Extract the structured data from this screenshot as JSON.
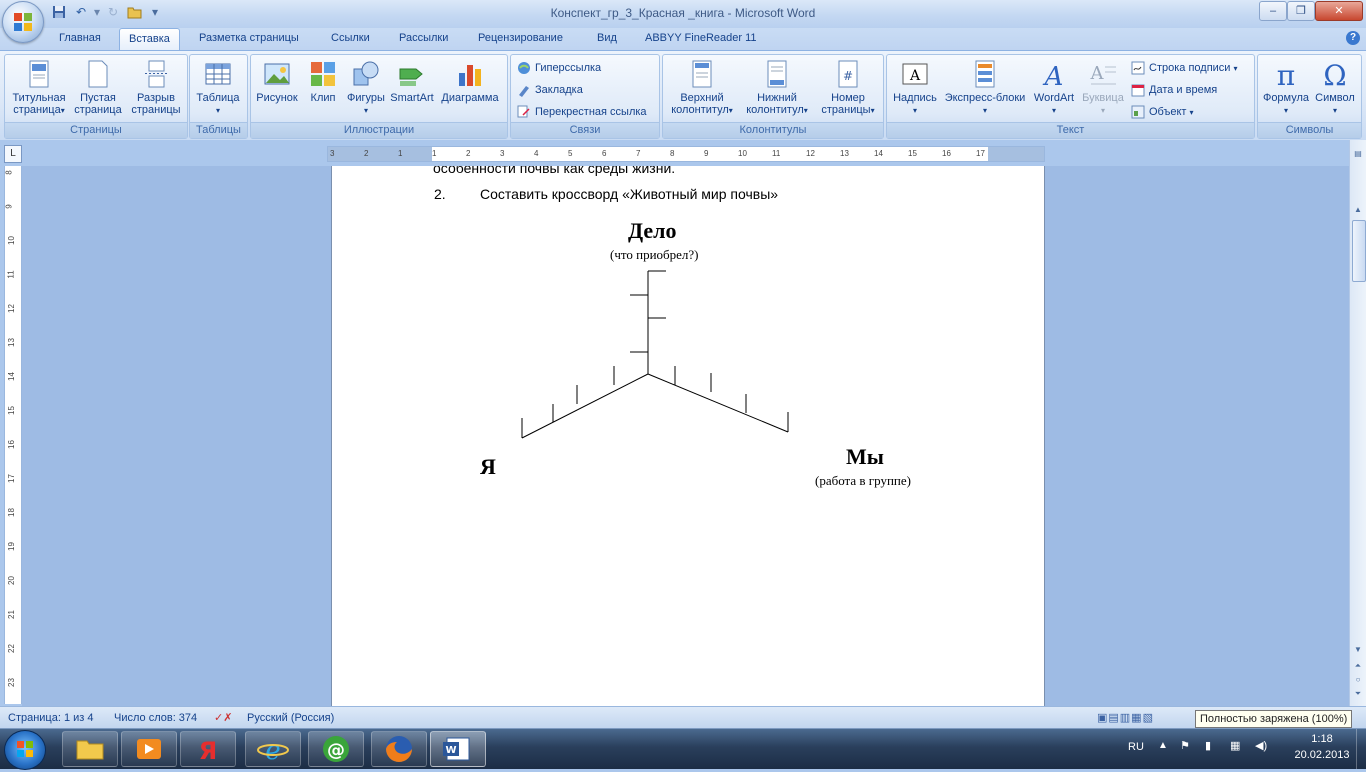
{
  "window": {
    "title": "Конспект_гр_3_Красная _книга - Microsoft Word",
    "qat": {
      "save": "save-icon",
      "undo": "undo-icon",
      "redo": "redo-icon",
      "open": "open-icon"
    }
  },
  "tabs": [
    "Главная",
    "Вставка",
    "Разметка страницы",
    "Ссылки",
    "Рассылки",
    "Рецензирование",
    "Вид",
    "ABBYY FineReader 11"
  ],
  "active_tab": "Вставка",
  "ribbon": {
    "pages": {
      "label": "Страницы",
      "cover": "Титульная страница",
      "blank": "Пустая страница",
      "break": "Разрыв страницы"
    },
    "tables": {
      "label": "Таблицы",
      "table": "Таблица"
    },
    "illustrations": {
      "label": "Иллюстрации",
      "picture": "Рисунок",
      "clip": "Клип",
      "shapes": "Фигуры",
      "smartart": "SmartArt",
      "chart": "Диаграмма"
    },
    "links": {
      "label": "Связи",
      "hyperlink": "Гиперссылка",
      "bookmark": "Закладка",
      "crossref": "Перекрестная ссылка"
    },
    "headers": {
      "label": "Колонтитулы",
      "header": "Верхний колонтитул",
      "footer": "Нижний колонтитул",
      "pagenum": "Номер страницы"
    },
    "text": {
      "label": "Текст",
      "textbox": "Надпись",
      "quickparts": "Экспресс-блоки",
      "wordart": "WordArt",
      "dropcap": "Буквица",
      "signature": "Строка подписи",
      "datetime": "Дата и время",
      "object": "Объект"
    },
    "symbols": {
      "label": "Символы",
      "equation": "Формула",
      "symbol": "Символ"
    }
  },
  "ruler": {
    "h": [
      "3",
      "2",
      "1",
      "1",
      "2",
      "3",
      "4",
      "5",
      "6",
      "7",
      "8",
      "9",
      "10",
      "11",
      "12",
      "13",
      "14",
      "15",
      "16",
      "17"
    ],
    "v": [
      "8",
      "9",
      "10",
      "11",
      "12",
      "13",
      "14",
      "15",
      "16",
      "17",
      "18",
      "19",
      "20",
      "21",
      "22",
      "23"
    ]
  },
  "document": {
    "line_top": "особенности почвы как среды жизни.",
    "item_number": "2.",
    "item_text": "Составить кроссворд «Животный мир почвы»",
    "diagram": {
      "top_title": "Дело",
      "top_sub": "(что приобрел?)",
      "left_title": "Я",
      "right_title": "Мы",
      "right_sub": "(работа в группе)"
    }
  },
  "status": {
    "page": "Страница: 1 из 4",
    "words": "Число слов: 374",
    "language": "Русский (Россия)",
    "battery_tooltip": "Полностью заряжена (100%)"
  },
  "tray": {
    "lang": "RU",
    "time": "1:18",
    "date": "20.02.2013"
  }
}
